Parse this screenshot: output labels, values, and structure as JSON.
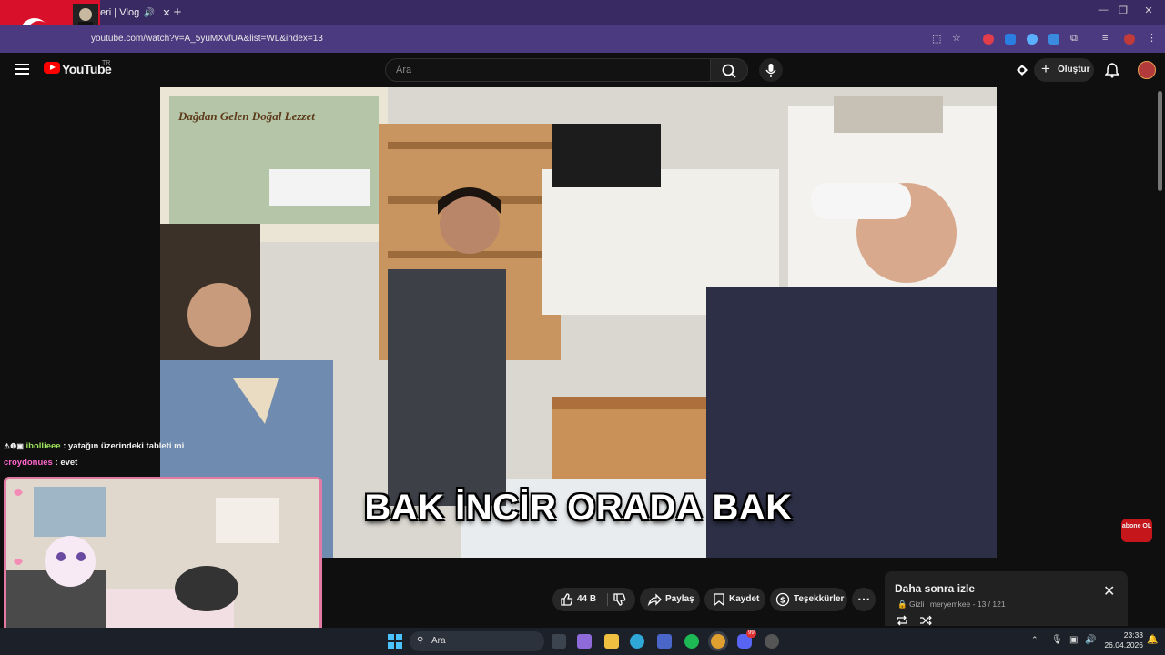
{
  "browser": {
    "tab_title": "eri | Vlog",
    "url": "youtube.com/watch?v=A_5yuMXvfUA&list=WL&index=13",
    "close_glyph": "✕",
    "new_tab_glyph": "+",
    "window_controls": [
      "—",
      "❐",
      "✕"
    ]
  },
  "youtube": {
    "logo_text": "YouTube",
    "region": "TR",
    "search_placeholder": "Ara",
    "create_label": "Oluştur"
  },
  "video": {
    "caption": "BAK İNCİR ORADA BAK",
    "sign_text": "Dağdan Gelen Doğal Lezzet",
    "watermark": "abone OL"
  },
  "actions": {
    "like_count": "44 B",
    "share_label": "Paylaş",
    "save_label": "Kaydet",
    "thanks_label": "Teşekkürler"
  },
  "watch_later": {
    "title": "Daha sonra izle",
    "visibility": "Gizli",
    "owner": "meryemkee",
    "position": "13 / 121",
    "separator": " - "
  },
  "chat": [
    {
      "user": "ibollieee",
      "message": "yatağın üzerindeki tableti mi",
      "color": "#9ee35e"
    },
    {
      "user": "croydonues",
      "message": "evet",
      "color": "#ff66cc"
    }
  ],
  "taskbar": {
    "search_placeholder": "Ara",
    "time": "23:33",
    "date": "26.04.2026",
    "badge_count": "99"
  },
  "colors": {
    "tabbar": "#3a2a63",
    "addressbar": "#4c3a80",
    "background": "#0f0f0f",
    "youtube_red": "#ff0000",
    "cam_frame": "#e27aa4"
  }
}
